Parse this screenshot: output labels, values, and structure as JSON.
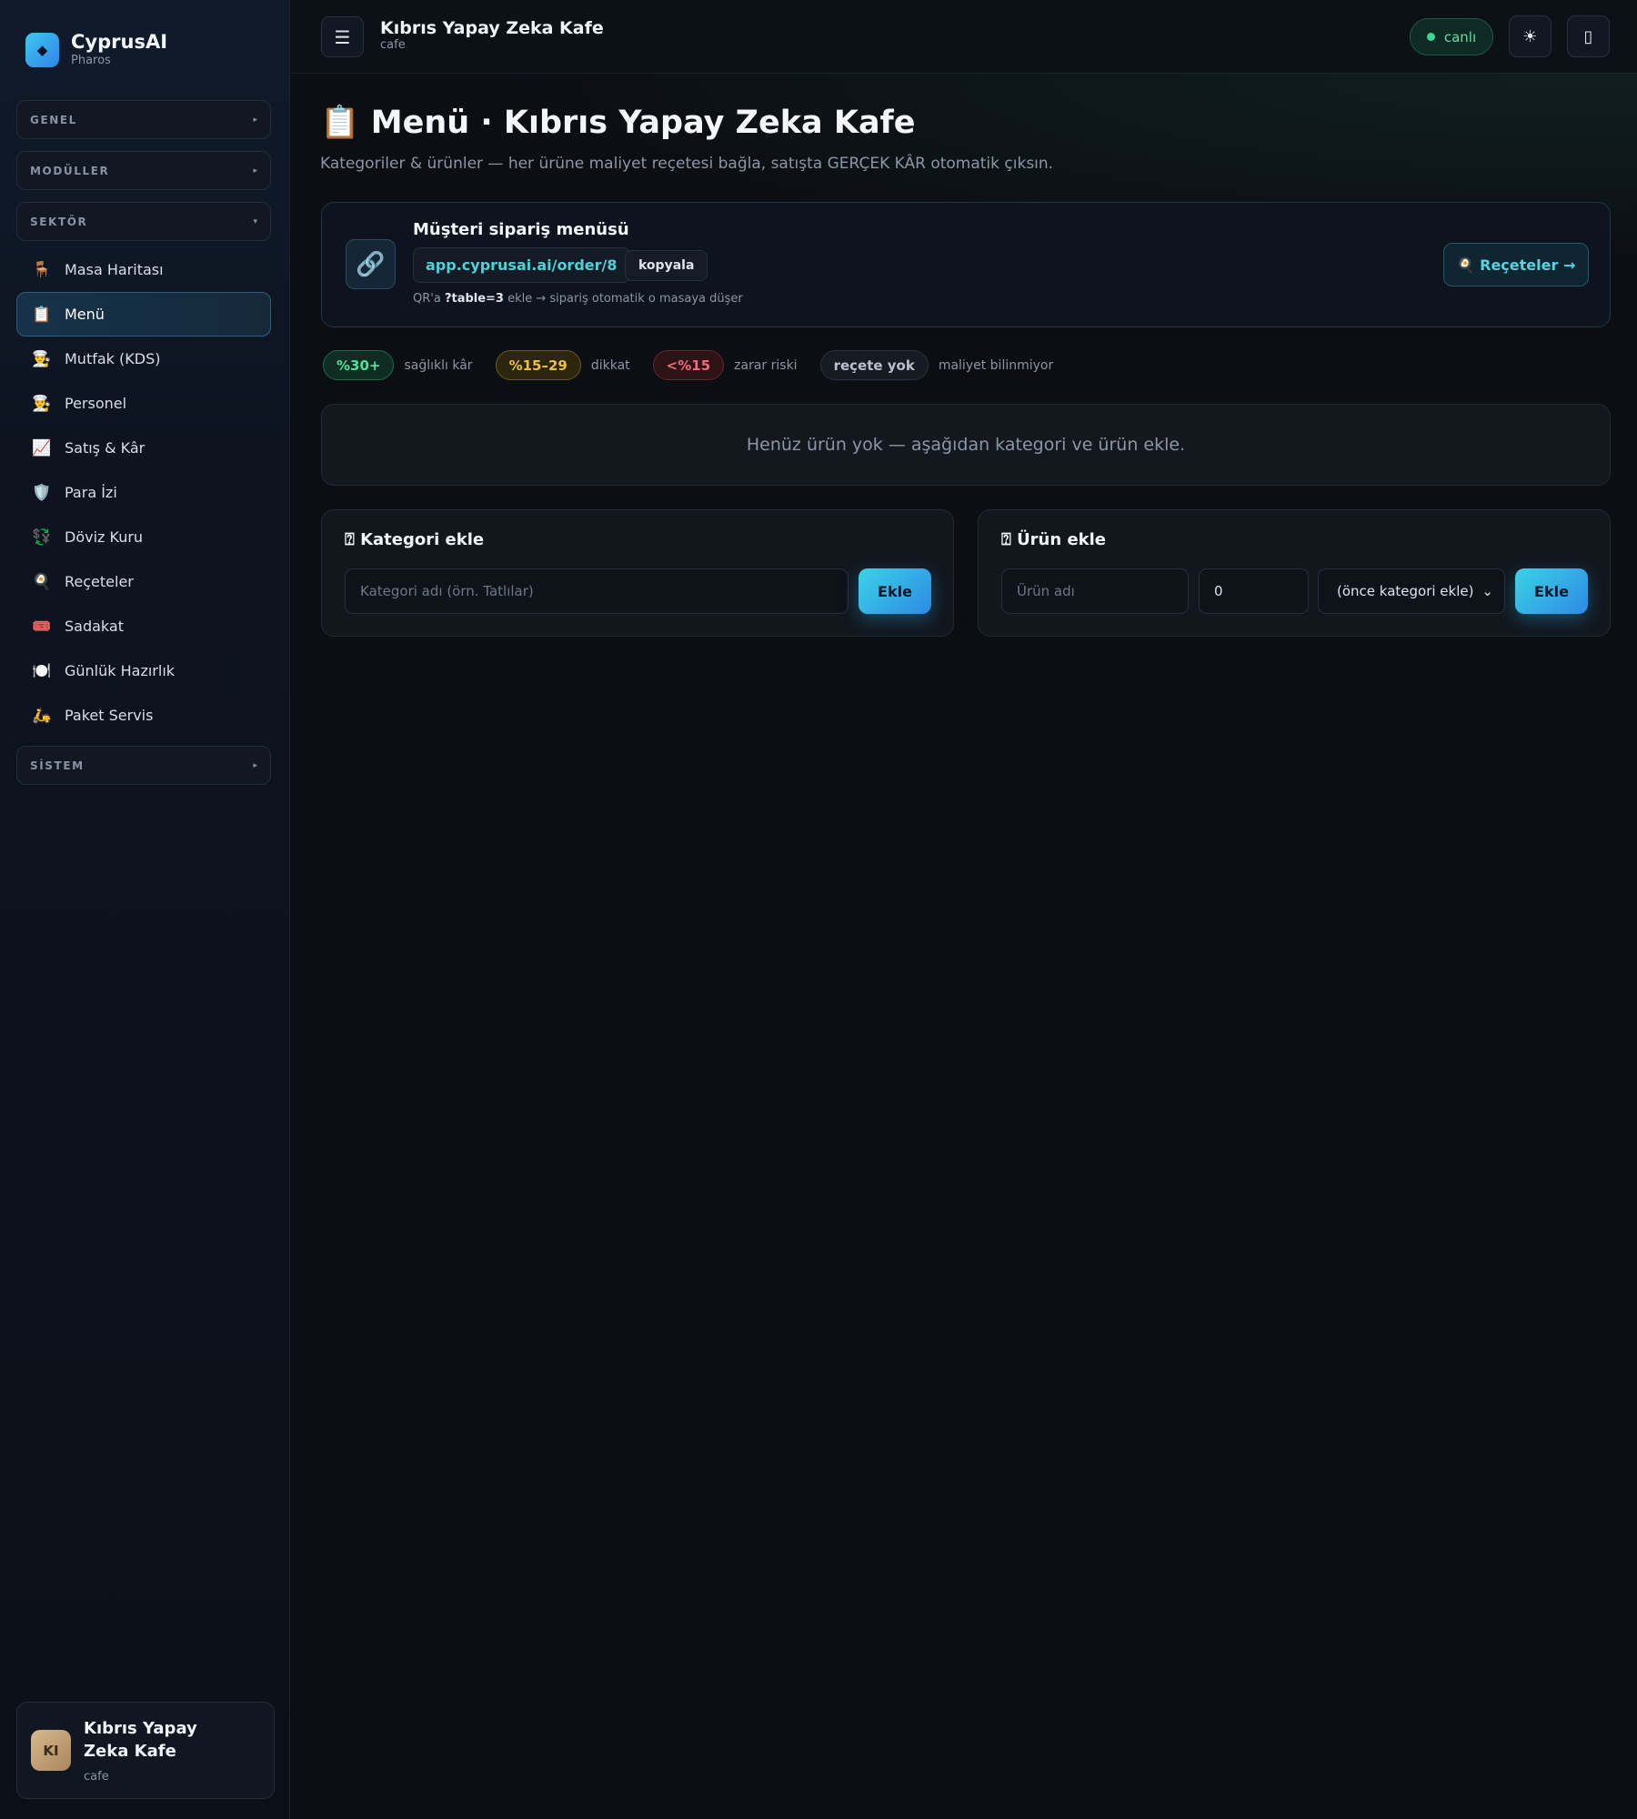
{
  "brand": {
    "logo_glyph": "◆",
    "name": "CyprusAI",
    "sub": "Pharos"
  },
  "sidebar": {
    "groups": [
      {
        "label": "GENEL",
        "caret": "▸"
      },
      {
        "label": "MODÜLLER",
        "caret": "▸"
      },
      {
        "label": "SEKTÖR",
        "caret": "▾"
      },
      {
        "label": "SİSTEM",
        "caret": "▸"
      }
    ],
    "items": [
      {
        "icon": "🪑",
        "label": "Masa Haritası",
        "icon_name": "chair-icon"
      },
      {
        "icon": "📋",
        "label": "Menü",
        "icon_name": "clipboard-icon",
        "active": true
      },
      {
        "icon": "👨‍🍳",
        "label": "Mutfak (KDS)",
        "icon_name": "chef-icon"
      },
      {
        "icon": "👨‍🍳",
        "label": "Personel",
        "icon_name": "chef-icon"
      },
      {
        "icon": "📈",
        "label": "Satış & Kâr",
        "icon_name": "chart-up-icon"
      },
      {
        "icon": "🛡️",
        "label": "Para İzi",
        "icon_name": "shield-icon"
      },
      {
        "icon": "💱",
        "label": "Döviz Kuru",
        "icon_name": "currency-exchange-icon"
      },
      {
        "icon": "🍳",
        "label": "Reçeteler",
        "icon_name": "cooking-icon"
      },
      {
        "icon": "🎟️",
        "label": "Sadakat",
        "icon_name": "ticket-icon"
      },
      {
        "icon": "🍽️",
        "label": "Günlük Hazırlık",
        "icon_name": "plate-icon"
      },
      {
        "icon": "🛵",
        "label": "Paket Servis",
        "icon_name": "scooter-icon"
      }
    ]
  },
  "profile": {
    "initials": "KI",
    "name": "Kıbrıs Yapay Zeka Kafe",
    "sub": "cafe"
  },
  "topbar": {
    "menu_glyph": "☰",
    "title": "Kıbrıs Yapay Zeka Kafe",
    "sub": "cafe",
    "live_label": "canlı",
    "theme_glyph": "☀",
    "device_glyph": "▯"
  },
  "page": {
    "title": "📋 Menü · Kıbrıs Yapay Zeka Kafe",
    "subtitle": "Kategoriler & ürünler — her ürüne maliyet reçetesi bağla, satışta GERÇEK KÂR otomatik çıksın."
  },
  "order_card": {
    "icon": "🔗",
    "title": "Müşteri sipariş menüsü",
    "url": "app.cyprusai.ai/order/8",
    "copy_label": "kopyala",
    "hint_prefix": "QR'a ",
    "hint_param": "?table=3",
    "hint_suffix": " ekle → sipariş otomatik o masaya düşer",
    "recipes_label": "🍳 Reçeteler →"
  },
  "legend": [
    {
      "chip": "%30+",
      "text": "sağlıklı kâr",
      "color": "#4fe09c"
    },
    {
      "chip": "%15–29",
      "text": "dikkat",
      "color": "#e8c14a"
    },
    {
      "chip": "<%15",
      "text": "zarar riski",
      "color": "#f26b7d"
    },
    {
      "chip": "reçete yok",
      "text": "maliyet bilinmiyor",
      "color": "#b9c0cc"
    }
  ],
  "empty_state": "Henüz ürün yok — aşağıdan kategori ve ürün ekle.",
  "category_panel": {
    "title": "⍰ Kategori ekle",
    "placeholder": "Kategori adı (örn. Tatlılar)",
    "button": "Ekle"
  },
  "product_panel": {
    "title": "⍰ Ürün ekle",
    "name_placeholder": "Ürün adı",
    "price_value": "0",
    "category_select": "(önce kategori ekle)",
    "button": "Ekle"
  }
}
